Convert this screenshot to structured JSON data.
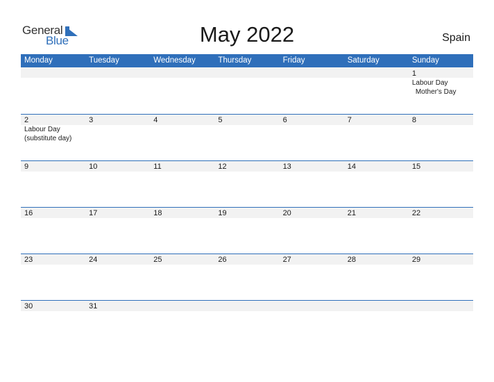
{
  "logo": {
    "word1": "General",
    "word2": "Blue",
    "accent": "#2f6fba"
  },
  "title": "May 2022",
  "country": "Spain",
  "weekdays": [
    "Monday",
    "Tuesday",
    "Wednesday",
    "Thursday",
    "Friday",
    "Saturday",
    "Sunday"
  ],
  "weeks": [
    [
      {
        "day": ""
      },
      {
        "day": ""
      },
      {
        "day": ""
      },
      {
        "day": ""
      },
      {
        "day": ""
      },
      {
        "day": ""
      },
      {
        "day": "1",
        "events": [
          "Labour Day",
          "Mother's Day"
        ]
      }
    ],
    [
      {
        "day": "2",
        "events": [
          "Labour Day",
          "(substitute day)"
        ]
      },
      {
        "day": "3"
      },
      {
        "day": "4"
      },
      {
        "day": "5"
      },
      {
        "day": "6"
      },
      {
        "day": "7"
      },
      {
        "day": "8"
      }
    ],
    [
      {
        "day": "9"
      },
      {
        "day": "10"
      },
      {
        "day": "11"
      },
      {
        "day": "12"
      },
      {
        "day": "13"
      },
      {
        "day": "14"
      },
      {
        "day": "15"
      }
    ],
    [
      {
        "day": "16"
      },
      {
        "day": "17"
      },
      {
        "day": "18"
      },
      {
        "day": "19"
      },
      {
        "day": "20"
      },
      {
        "day": "21"
      },
      {
        "day": "22"
      }
    ],
    [
      {
        "day": "23"
      },
      {
        "day": "24"
      },
      {
        "day": "25"
      },
      {
        "day": "26"
      },
      {
        "day": "27"
      },
      {
        "day": "28"
      },
      {
        "day": "29"
      }
    ],
    [
      {
        "day": "30"
      },
      {
        "day": "31"
      },
      {
        "day": ""
      },
      {
        "day": ""
      },
      {
        "day": ""
      },
      {
        "day": ""
      },
      {
        "day": ""
      }
    ]
  ]
}
